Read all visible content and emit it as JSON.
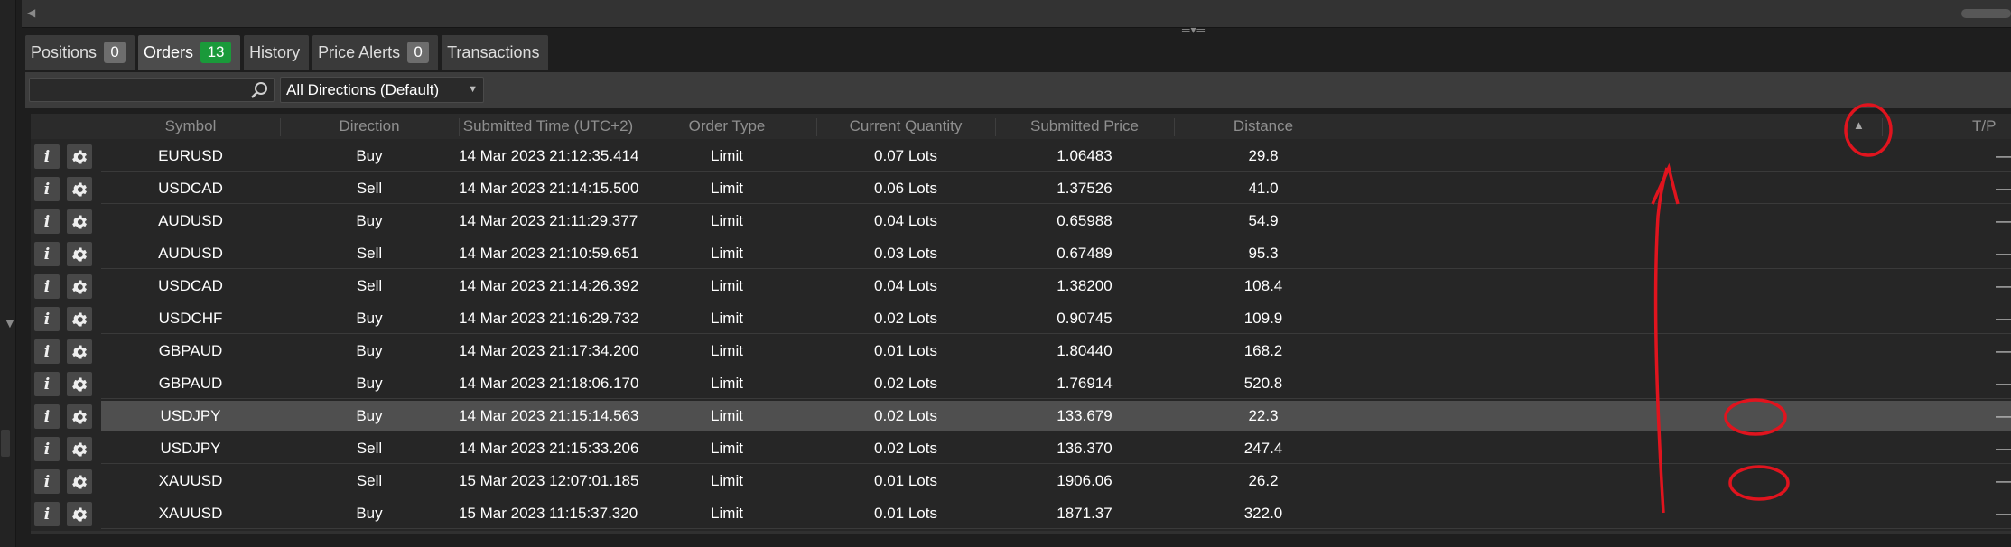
{
  "tabs": [
    {
      "label": "Positions",
      "count": "0"
    },
    {
      "label": "Orders",
      "count": "13"
    },
    {
      "label": "History"
    },
    {
      "label": "Price Alerts",
      "count": "0"
    },
    {
      "label": "Transactions"
    }
  ],
  "filters": {
    "search_value": "",
    "direction_selected": "All Directions (Default)"
  },
  "table": {
    "columns": [
      "Symbol",
      "Direction",
      "Submitted Time (UTC+2)",
      "Order Type",
      "Current Quantity",
      "Submitted Price",
      "Distance",
      "T/P"
    ],
    "rows": [
      {
        "symbol": "EURUSD",
        "direction": "Buy",
        "time": "14 Mar 2023 21:12:35.414",
        "type": "Limit",
        "qty": "0.07 Lots",
        "price": "1.06483",
        "distance": "29.8",
        "tp": "—"
      },
      {
        "symbol": "USDCAD",
        "direction": "Sell",
        "time": "14 Mar 2023 21:14:15.500",
        "type": "Limit",
        "qty": "0.06 Lots",
        "price": "1.37526",
        "distance": "41.0",
        "tp": "—"
      },
      {
        "symbol": "AUDUSD",
        "direction": "Buy",
        "time": "14 Mar 2023 21:11:29.377",
        "type": "Limit",
        "qty": "0.04 Lots",
        "price": "0.65988",
        "distance": "54.9",
        "tp": "—"
      },
      {
        "symbol": "AUDUSD",
        "direction": "Sell",
        "time": "14 Mar 2023 21:10:59.651",
        "type": "Limit",
        "qty": "0.03 Lots",
        "price": "0.67489",
        "distance": "95.3",
        "tp": "—"
      },
      {
        "symbol": "USDCAD",
        "direction": "Sell",
        "time": "14 Mar 2023 21:14:26.392",
        "type": "Limit",
        "qty": "0.04 Lots",
        "price": "1.38200",
        "distance": "108.4",
        "tp": "—"
      },
      {
        "symbol": "USDCHF",
        "direction": "Buy",
        "time": "14 Mar 2023 21:16:29.732",
        "type": "Limit",
        "qty": "0.02 Lots",
        "price": "0.90745",
        "distance": "109.9",
        "tp": "—"
      },
      {
        "symbol": "GBPAUD",
        "direction": "Buy",
        "time": "14 Mar 2023 21:17:34.200",
        "type": "Limit",
        "qty": "0.01 Lots",
        "price": "1.80440",
        "distance": "168.2",
        "tp": "—"
      },
      {
        "symbol": "GBPAUD",
        "direction": "Buy",
        "time": "14 Mar 2023 21:18:06.170",
        "type": "Limit",
        "qty": "0.02 Lots",
        "price": "1.76914",
        "distance": "520.8",
        "tp": "—"
      },
      {
        "symbol": "USDJPY",
        "direction": "Buy",
        "time": "14 Mar 2023 21:15:14.563",
        "type": "Limit",
        "qty": "0.02 Lots",
        "price": "133.679",
        "distance": "22.3",
        "tp": "—",
        "selected": true
      },
      {
        "symbol": "USDJPY",
        "direction": "Sell",
        "time": "14 Mar 2023 21:15:33.206",
        "type": "Limit",
        "qty": "0.02 Lots",
        "price": "136.370",
        "distance": "247.4",
        "tp": "—"
      },
      {
        "symbol": "XAUUSD",
        "direction": "Sell",
        "time": "15 Mar 2023 12:07:01.185",
        "type": "Limit",
        "qty": "0.01 Lots",
        "price": "1906.06",
        "distance": "26.2",
        "tp": "—"
      },
      {
        "symbol": "XAUUSD",
        "direction": "Buy",
        "time": "15 Mar 2023 11:15:37.320",
        "type": "Limit",
        "qty": "0.01 Lots",
        "price": "1871.37",
        "distance": "322.0",
        "tp": "—"
      }
    ]
  },
  "colors": {
    "background": "#1e1e1e",
    "tab_active": "#4c4c4c",
    "badge_green": "#1a9a3a",
    "row_selected": "#4f4f4f",
    "annotation_red": "#e0141e"
  }
}
